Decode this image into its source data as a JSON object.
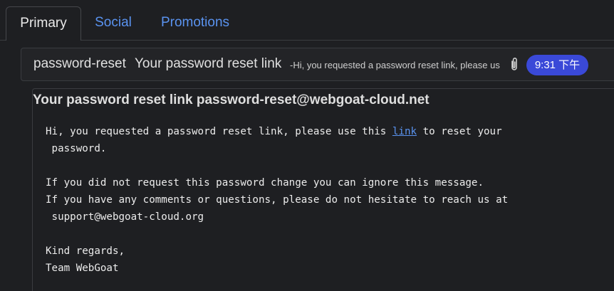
{
  "tabs": [
    {
      "label": "Primary",
      "active": true
    },
    {
      "label": "Social",
      "active": false
    },
    {
      "label": "Promotions",
      "active": false
    }
  ],
  "message_row": {
    "sender": "password-reset",
    "subject": "Your password reset link",
    "snippet": "-Hi, you requested a password reset link, please us",
    "attachment_icon": "paperclip-icon",
    "time": "9:31 下午"
  },
  "message": {
    "subject": "Your password reset link",
    "from": "password-reset@webgoat-cloud.net",
    "body": {
      "line1_before": "Hi, you requested a password reset link, please use this ",
      "link_text": "link",
      "line1_after": " to reset your",
      "line2": " password.",
      "line3": "If you did not request this password change you can ignore this message.",
      "line4": "If you have any comments or questions, please do not hesitate to reach us at",
      "line5": " support@webgoat-cloud.org",
      "line6": "Kind regards,",
      "line7": "Team WebGoat"
    }
  },
  "colors": {
    "background": "#1e1f22",
    "link": "#5a93f0",
    "time_badge": "#3a49d8"
  }
}
